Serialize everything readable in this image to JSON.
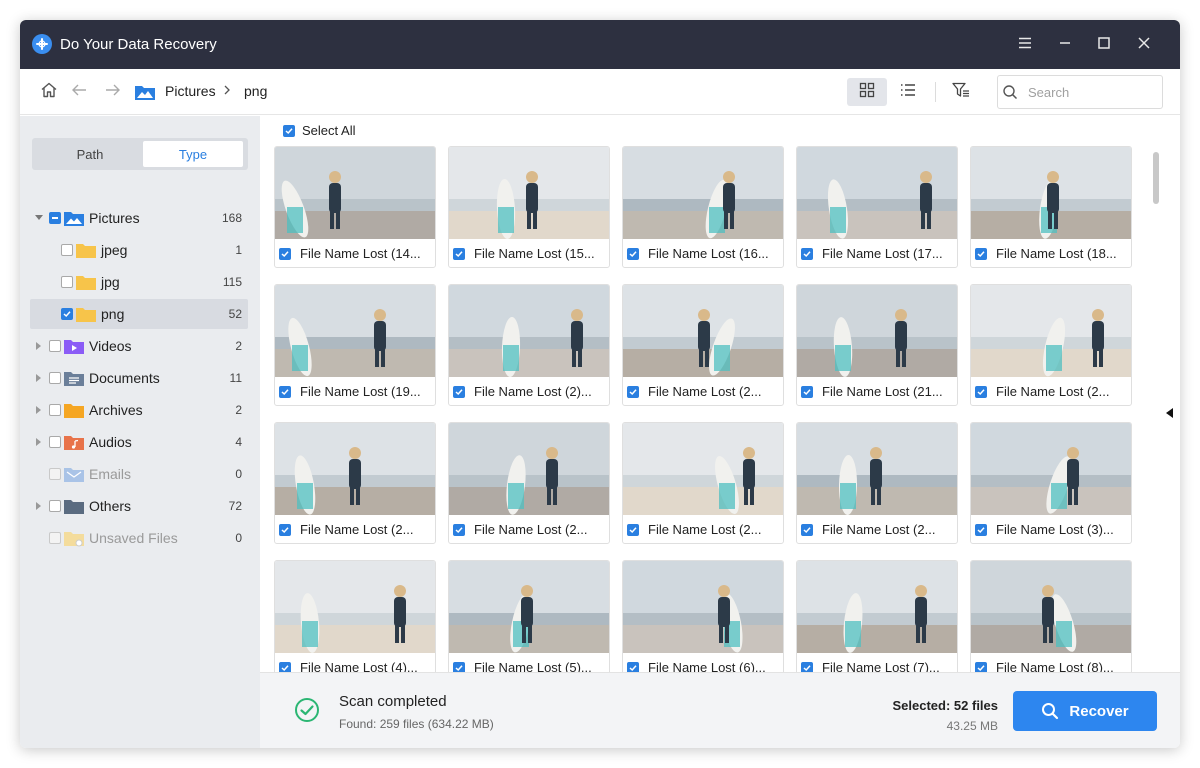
{
  "app": {
    "title": "Do Your Data Recovery"
  },
  "toolbar": {
    "breadcrumb": [
      "Pictures",
      "png"
    ],
    "search_placeholder": "Search"
  },
  "sidebar": {
    "tabs": [
      {
        "label": "Path",
        "active": false
      },
      {
        "label": "Type",
        "active": true
      }
    ],
    "tree": [
      {
        "label": "Pictures",
        "count": "168",
        "level": 0,
        "expanded": true,
        "check": "partial",
        "icon": "pictures-folder-icon",
        "color": "#2a7fe0"
      },
      {
        "label": "jpeg",
        "count": "1",
        "level": 1,
        "check": "none",
        "icon": "folder-icon",
        "color": "#f7c44a"
      },
      {
        "label": "jpg",
        "count": "115",
        "level": 1,
        "check": "none",
        "icon": "folder-icon",
        "color": "#f7c44a"
      },
      {
        "label": "png",
        "count": "52",
        "level": 1,
        "check": "checked",
        "selected": true,
        "icon": "folder-icon",
        "color": "#f7c44a"
      },
      {
        "label": "Videos",
        "count": "2",
        "level": 0,
        "check": "none",
        "icon": "videos-folder-icon",
        "color": "#8b5cf6"
      },
      {
        "label": "Documents",
        "count": "11",
        "level": 0,
        "check": "none",
        "icon": "documents-folder-icon",
        "color": "#6b7f99"
      },
      {
        "label": "Archives",
        "count": "2",
        "level": 0,
        "check": "none",
        "icon": "archives-folder-icon",
        "color": "#f5a623"
      },
      {
        "label": "Audios",
        "count": "4",
        "level": 0,
        "check": "none",
        "icon": "audios-folder-icon",
        "color": "#e8734a"
      },
      {
        "label": "Emails",
        "count": "0",
        "level": 0,
        "check": "disabled",
        "disabled": true,
        "icon": "emails-folder-icon",
        "color": "#a9c3e6"
      },
      {
        "label": "Others",
        "count": "72",
        "level": 0,
        "check": "none",
        "icon": "others-folder-icon",
        "color": "#5b6b80"
      },
      {
        "label": "Unsaved Files",
        "count": "0",
        "level": 0,
        "check": "disabled",
        "disabled": true,
        "icon": "unsaved-files-folder-icon",
        "color": "#f3dc9c"
      }
    ]
  },
  "main": {
    "select_all_label": "Select All",
    "files": [
      "File Name Lost (14...",
      "File Name Lost (15...",
      "File Name Lost (16...",
      "File Name Lost (17...",
      "File Name Lost (18...",
      "File Name Lost (19...",
      "File Name Lost (2)...",
      "File Name Lost (2...",
      "File Name Lost (21...",
      "File Name Lost (2...",
      "File Name Lost (2...",
      "File Name Lost (2...",
      "File Name Lost (2...",
      "File Name Lost (2...",
      "File Name Lost (3)...",
      "File Name Lost (4)...",
      "File Name Lost (5)...",
      "File Name Lost (6)...",
      "File Name Lost (7)...",
      "File Name Lost (8)..."
    ]
  },
  "footer": {
    "status_title": "Scan completed",
    "status_sub": "Found: 259 files (634.22 MB)",
    "selected_title": "Selected: 52 files",
    "selected_size": "43.25 MB",
    "recover_label": "Recover"
  },
  "colors": {
    "accent": "#2d86ef",
    "titlebar": "#2d3040",
    "success": "#2bb673"
  }
}
